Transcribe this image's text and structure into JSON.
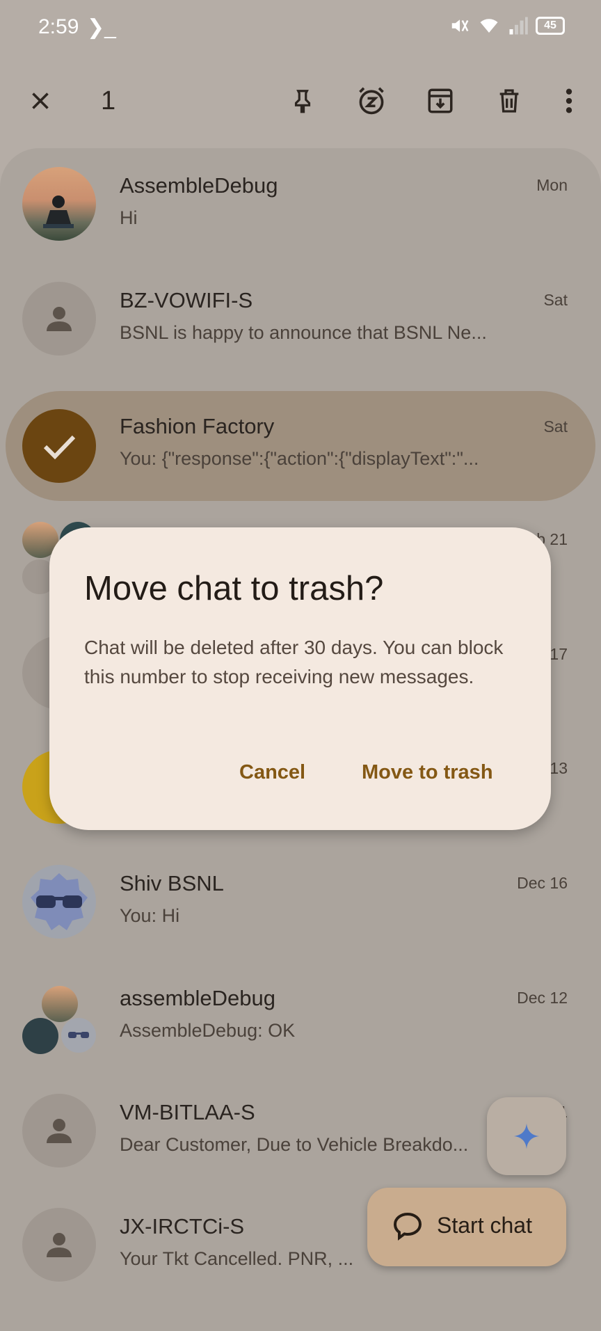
{
  "status_bar": {
    "time": "2:59",
    "terminal_glyph": "❯_",
    "battery": "45"
  },
  "action_bar": {
    "selected_count": "1"
  },
  "conversations": [
    {
      "name": "AssembleDebug",
      "snippet": "Hi",
      "time": "Mon",
      "avatar": "photo"
    },
    {
      "name": "BZ-VOWIFI-S",
      "snippet": "BSNL is happy to announce that BSNL Ne...",
      "time": "Sat",
      "avatar": "person"
    },
    {
      "name": "Fashion Factory",
      "snippet": "You: {\"response\":{\"action\":{\"displayText\":\"...",
      "time": "Sat",
      "avatar": "selected"
    },
    {
      "name": "",
      "snippet": "",
      "time": "b 21",
      "avatar": "group"
    },
    {
      "name": "",
      "snippet": "",
      "time": "17",
      "avatar": "person"
    },
    {
      "name": "",
      "snippet": "",
      "time": "13",
      "avatar": "yellow"
    },
    {
      "name": "Shiv BSNL",
      "snippet": "You: Hi",
      "time": "Dec 16",
      "avatar": "glasses"
    },
    {
      "name": "assembleDebug",
      "snippet": "AssembleDebug: OK",
      "time": "Dec 12",
      "avatar": "group"
    },
    {
      "name": "VM-BITLAA-S",
      "snippet": "Dear Customer, Due to Vehicle Breakdo...",
      "time": "1",
      "avatar": "person"
    },
    {
      "name": "JX-IRCTCi-S",
      "snippet": "Your Tkt Cancelled. PNR, ...",
      "time": "",
      "avatar": "person"
    }
  ],
  "dialog": {
    "title": "Move chat to trash?",
    "body": "Chat will be deleted after 30 days. You can block this number to stop receiving new messages.",
    "cancel": "Cancel",
    "confirm": "Move to trash"
  },
  "fab": {
    "start_chat": "Start chat"
  },
  "colors": {
    "accent": "#845814",
    "selected_check": "#6b4511",
    "dialog_bg": "#f4e9e0"
  }
}
